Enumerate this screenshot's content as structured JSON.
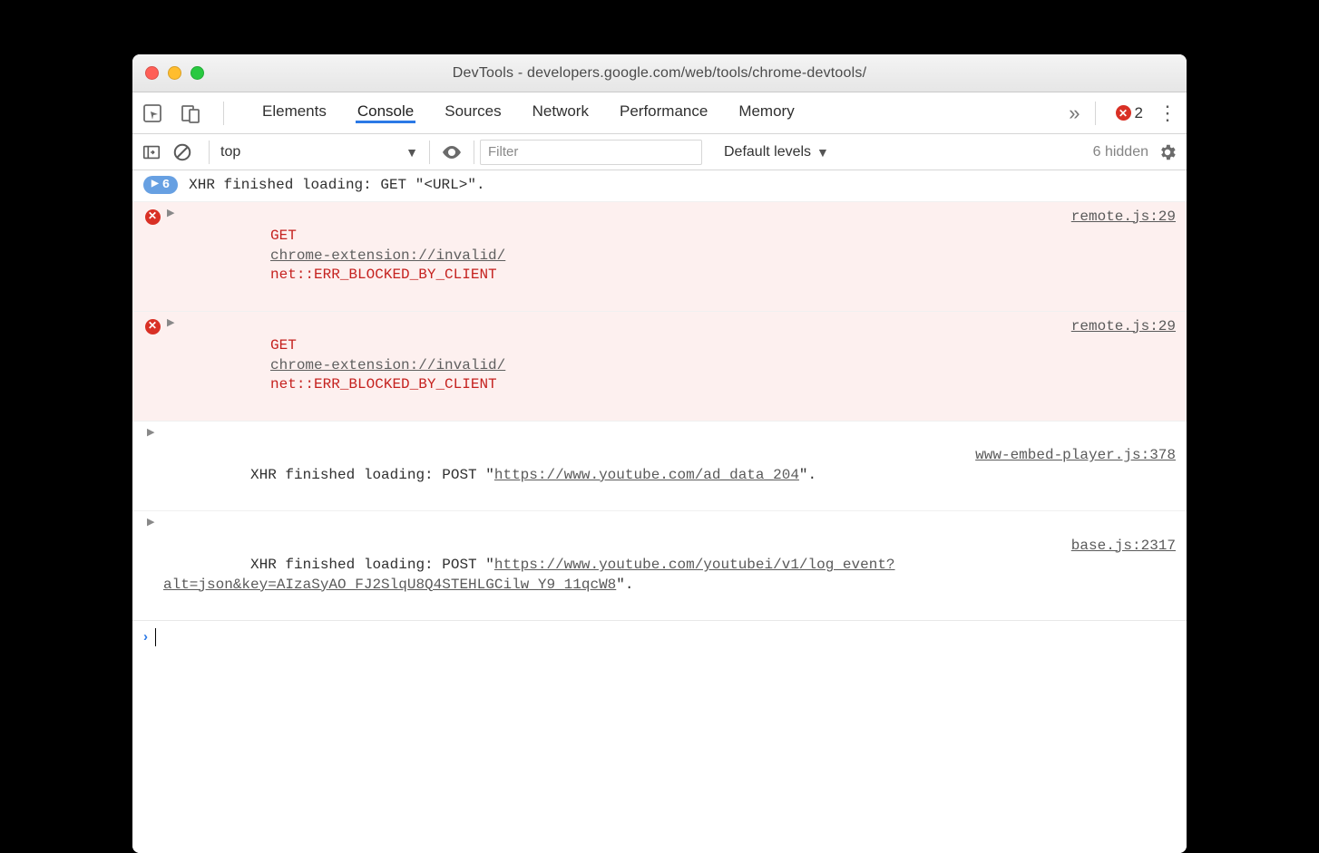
{
  "titlebar": {
    "title": "DevTools - developers.google.com/web/tools/chrome-devtools/"
  },
  "tabs": {
    "items": [
      "Elements",
      "Console",
      "Sources",
      "Network",
      "Performance",
      "Memory"
    ],
    "active_index": 1,
    "error_count": "2",
    "more_glyph": "»"
  },
  "filterbar": {
    "context": "top",
    "filter_placeholder": "Filter",
    "levels": "Default levels",
    "hidden_text": "6 hidden"
  },
  "console": {
    "pill_count": "6",
    "rows": [
      {
        "type": "info-pill",
        "text": "XHR finished loading: GET \"<URL>\"."
      },
      {
        "type": "error",
        "method": "GET",
        "url": "chrome-extension://invalid/",
        "err": "net::ERR_BLOCKED_BY_CLIENT",
        "source": "remote.js:29"
      },
      {
        "type": "error",
        "method": "GET",
        "url": "chrome-extension://invalid/",
        "err": "net::ERR_BLOCKED_BY_CLIENT",
        "source": "remote.js:29"
      },
      {
        "type": "log",
        "prefix": "XHR finished loading: POST \"",
        "url": "https://www.youtube.com/ad_data_204",
        "suffix": "\".",
        "source": "www-embed-player.js:378"
      },
      {
        "type": "log",
        "prefix": "XHR finished loading: POST \"",
        "url": "https://www.youtube.com/youtubei/v1/log_event?alt=json&key=AIzaSyAO_FJ2SlqU8Q4STEHLGCilw_Y9_11qcW8",
        "suffix": "\".",
        "source": "base.js:2317"
      }
    ]
  }
}
